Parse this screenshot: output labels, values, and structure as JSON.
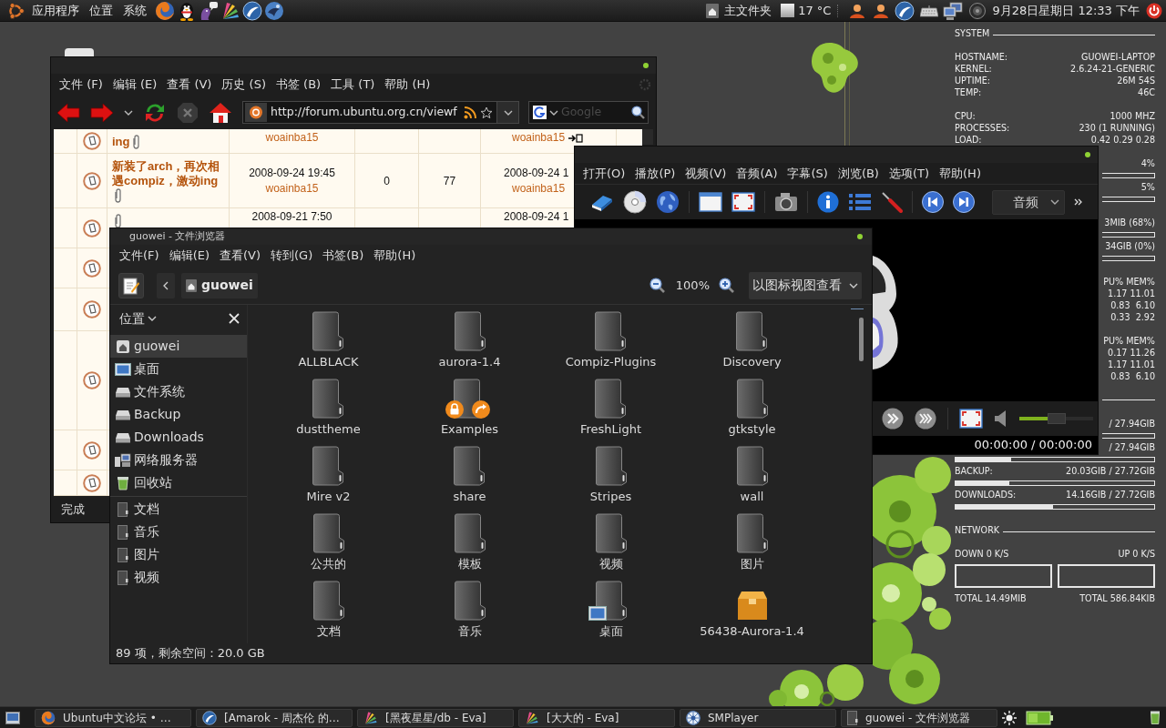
{
  "top_panel": {
    "menus": [
      "应用程序",
      "位置",
      "系统"
    ],
    "home_label": "主文件夹",
    "temperature": "17 °C",
    "clock": "9月28日星期日 12:33 下午"
  },
  "browser": {
    "menus": [
      "文件 (F)",
      "编辑 (E)",
      "查看 (V)",
      "历史 (S)",
      "书签 (B)",
      "工具 (T)",
      "帮助 (H)"
    ],
    "url": "http://forum.ubuntu.org.cn/viewf",
    "search_placeholder": "Google",
    "rows": [
      {
        "topic": "ing",
        "attachment": true,
        "author": "woainba15",
        "last_author": "woainba15",
        "jump": true
      },
      {
        "topic": "新装了arch，再次相遇compiz，激动ing",
        "attachment": true,
        "posted": "2008-09-24 19:45",
        "author": "woainba15",
        "replies": "0",
        "views": "77",
        "last_post": "2008-09-24 1",
        "last_author": "woainba15",
        "jump": false
      },
      {
        "attachment": true,
        "posted": "2008-09-21 7:50",
        "last_post": "2008-09-24 1",
        "jump": false
      },
      {
        "attachment": false,
        "jump": false
      },
      {
        "attachment": false,
        "jump": false
      },
      {
        "attachment": false,
        "jump": false
      },
      {
        "attachment": false,
        "jump": false
      },
      {
        "attachment": false,
        "jump": false
      }
    ],
    "status": "完成"
  },
  "player": {
    "menus": [
      "打开(O)",
      "播放(P)",
      "视频(V)",
      "音频(A)",
      "字幕(S)",
      "浏览(B)",
      "选项(T)",
      "帮助(H)"
    ],
    "audio_track": "音频",
    "volume": {
      "level": 0.5
    },
    "time": "00:00:00 / 00:00:00"
  },
  "file_browser": {
    "title": "guowei - 文件浏览器",
    "menus": [
      "文件(F)",
      "编辑(E)",
      "查看(V)",
      "转到(G)",
      "书签(B)",
      "帮助(H)"
    ],
    "location": "guowei",
    "zoom": "100%",
    "view_mode": "以图标视图查看",
    "sidebar": {
      "title": "位置",
      "places": [
        {
          "label": "guowei",
          "kind": "home",
          "selected": true
        },
        {
          "label": "桌面",
          "kind": "desktop",
          "selected": false
        },
        {
          "label": "文件系统",
          "kind": "drive",
          "selected": false
        },
        {
          "label": "Backup",
          "kind": "drive",
          "selected": false
        },
        {
          "label": "Downloads",
          "kind": "drive",
          "selected": false
        },
        {
          "label": "网络服务器",
          "kind": "network",
          "selected": false
        },
        {
          "label": "回收站",
          "kind": "trash",
          "selected": false
        }
      ],
      "bookmarks": [
        {
          "label": "文档",
          "selected": false
        },
        {
          "label": "音乐",
          "selected": false
        },
        {
          "label": "图片",
          "selected": false
        },
        {
          "label": "视频",
          "selected": false
        }
      ]
    },
    "items": [
      {
        "name": "ALLBLACK",
        "kind": "folder",
        "selected": false
      },
      {
        "name": "aurora-1.4",
        "kind": "folder",
        "selected": false
      },
      {
        "name": "Compiz-Plugins",
        "kind": "folder",
        "selected": false
      },
      {
        "name": "Discovery",
        "kind": "folder",
        "selected": false
      },
      {
        "name": "dusttheme",
        "kind": "folder",
        "selected": false
      },
      {
        "name": "Examples",
        "kind": "link",
        "selected": false
      },
      {
        "name": "FreshLight",
        "kind": "folder",
        "selected": false
      },
      {
        "name": "gtkstyle",
        "kind": "folder",
        "selected": false
      },
      {
        "name": "Mire v2",
        "kind": "folder",
        "selected": false
      },
      {
        "name": "share",
        "kind": "folder",
        "selected": false
      },
      {
        "name": "Stripes",
        "kind": "folder",
        "selected": false
      },
      {
        "name": "wall",
        "kind": "folder",
        "selected": false
      },
      {
        "name": "公共的",
        "kind": "folder",
        "selected": false
      },
      {
        "name": "模板",
        "kind": "folder",
        "selected": false
      },
      {
        "name": "视频",
        "kind": "folder",
        "selected": false
      },
      {
        "name": "图片",
        "kind": "folder",
        "selected": false
      },
      {
        "name": "文档",
        "kind": "folder",
        "selected": false
      },
      {
        "name": "音乐",
        "kind": "folder",
        "selected": false
      },
      {
        "name": "桌面",
        "kind": "desktop",
        "selected": false
      },
      {
        "name": "56438-Aurora-1.4",
        "kind": "archive",
        "selected": false
      }
    ],
    "status": "89 项，剩余空间：20.0 GB"
  },
  "monitor": {
    "lines": [
      {
        "kind": "heading",
        "text": "SYSTEM"
      },
      {
        "kind": "blank"
      },
      {
        "kind": "pair",
        "label": "HOSTNAME:",
        "value": "GUOWEI-LAPTOP"
      },
      {
        "kind": "pair",
        "label": "KERNEL:",
        "value": "2.6.24-21-GENERIC"
      },
      {
        "kind": "pair",
        "label": "UPTIME:",
        "value": "26M 54S"
      },
      {
        "kind": "pair",
        "label": "TEMP:",
        "value": "46C"
      },
      {
        "kind": "blank"
      },
      {
        "kind": "pair",
        "label": "CPU:",
        "value": "1000 MHZ"
      },
      {
        "kind": "pair",
        "label": "PROCESSES:",
        "value": "230 (1 RUNNING)"
      },
      {
        "kind": "pair",
        "label": "LOAD:",
        "value": "0.42 0.29 0.28"
      },
      {
        "kind": "blank"
      },
      {
        "kind": "value",
        "value": "4%"
      },
      {
        "kind": "stub"
      },
      {
        "kind": "value",
        "value": "5%"
      },
      {
        "kind": "stub"
      },
      {
        "kind": "blank"
      },
      {
        "kind": "value",
        "value": "3MIB (68%)"
      },
      {
        "kind": "stub"
      },
      {
        "kind": "value",
        "value": "34GIB (0%)"
      },
      {
        "kind": "stub"
      },
      {
        "kind": "blank"
      },
      {
        "kind": "value",
        "value": "PU% MEM%"
      },
      {
        "kind": "value",
        "value": "1.17 11.01"
      },
      {
        "kind": "value",
        "value": "0.83  6.10"
      },
      {
        "kind": "value",
        "value": "0.33  2.92"
      },
      {
        "kind": "blank"
      },
      {
        "kind": "value",
        "value": "PU% MEM%"
      },
      {
        "kind": "value",
        "value": "0.17 11.26"
      },
      {
        "kind": "value",
        "value": "1.17 11.01"
      },
      {
        "kind": "value",
        "value": "0.83  6.10"
      },
      {
        "kind": "blank"
      },
      {
        "kind": "rule"
      },
      {
        "kind": "blank"
      },
      {
        "kind": "value",
        "value": "/ 27.94GIB"
      },
      {
        "kind": "stub"
      },
      {
        "kind": "value",
        "value": "/ 27.94GIB"
      },
      {
        "kind": "bar",
        "level": 0.28
      },
      {
        "kind": "pair",
        "label": "BACKUP:",
        "value": "20.03GIB / 27.72GIB"
      },
      {
        "kind": "bar",
        "level": 0.27
      },
      {
        "kind": "pair",
        "label": "DOWNLOADS:",
        "value": "14.16GIB / 27.72GIB"
      },
      {
        "kind": "bar",
        "level": 0.49
      },
      {
        "kind": "blank"
      },
      {
        "kind": "heading",
        "text": "NETWORK"
      },
      {
        "kind": "blank"
      },
      {
        "kind": "pair",
        "label": "DOWN 0 K/S",
        "value": "UP 0 K/S"
      },
      {
        "kind": "graphs"
      },
      {
        "kind": "pair",
        "label": "TOTAL 14.49MIB",
        "value": "TOTAL 586.84KIB"
      }
    ]
  },
  "taskbar": {
    "tasks": [
      {
        "label": "Ubuntu中文论坛 • …",
        "kind": "browser",
        "selected": false
      },
      {
        "label": "[Amarok - 周杰伦 的…",
        "kind": "music",
        "selected": false
      },
      {
        "label": "[黑夜星星/db - Eva]",
        "kind": "chat",
        "selected": false
      },
      {
        "label": "[大大的 - Eva]",
        "kind": "chat",
        "selected": false
      },
      {
        "label": "SMPlayer",
        "kind": "video",
        "selected": false
      },
      {
        "label": "guowei - 文件浏览器",
        "kind": "files",
        "selected": false
      }
    ]
  }
}
